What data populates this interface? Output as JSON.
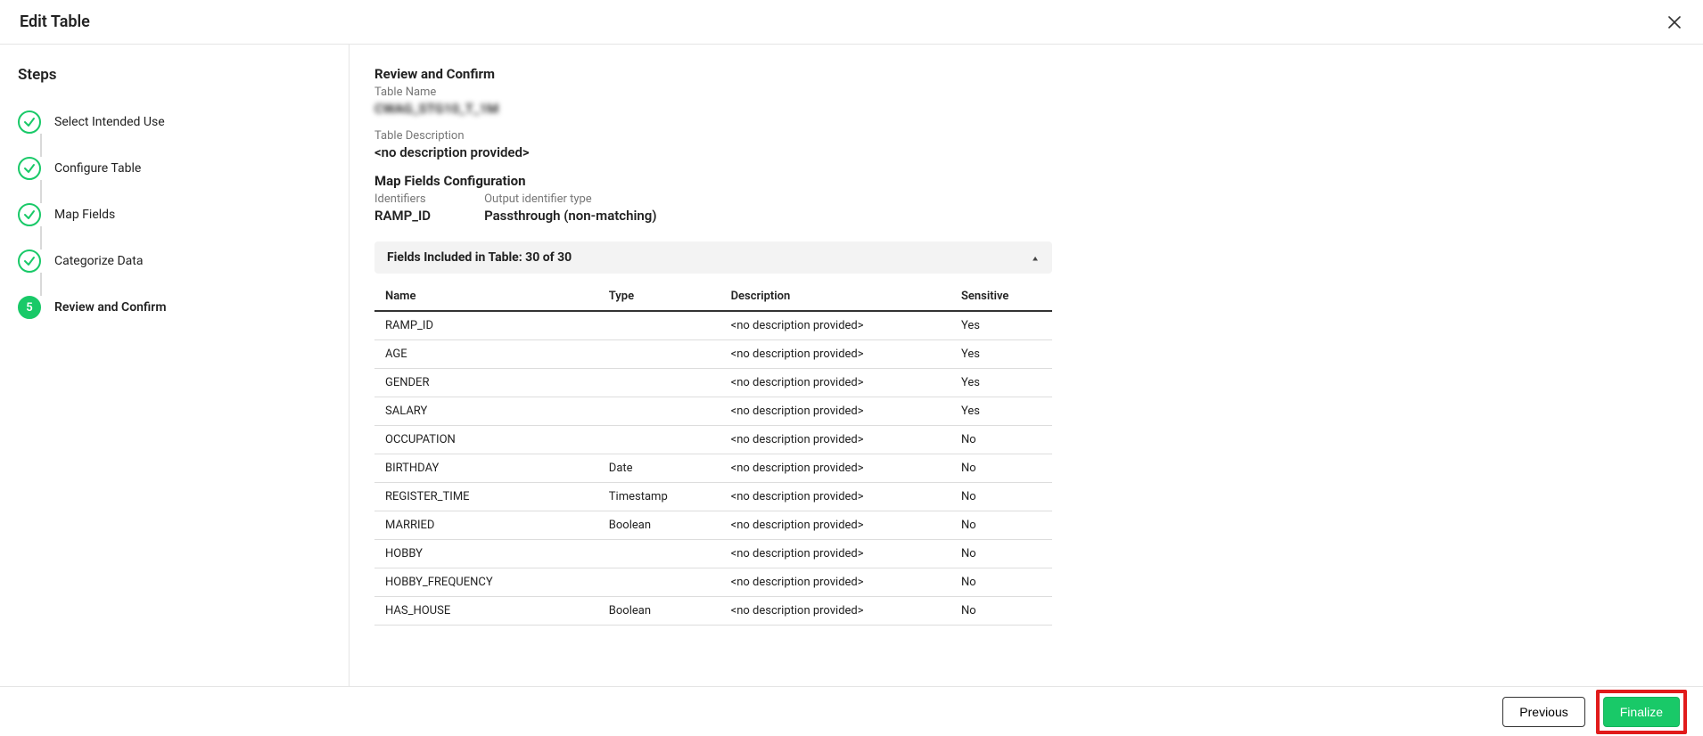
{
  "header": {
    "title": "Edit Table"
  },
  "sidebar": {
    "title": "Steps",
    "steps": [
      {
        "label": "Select Intended Use",
        "state": "completed"
      },
      {
        "label": "Configure Table",
        "state": "completed"
      },
      {
        "label": "Map Fields",
        "state": "completed"
      },
      {
        "label": "Categorize Data",
        "state": "completed"
      },
      {
        "label": "Review and Confirm",
        "state": "current",
        "number": "5"
      }
    ]
  },
  "review": {
    "heading": "Review and Confirm",
    "table_name_label": "Table Name",
    "table_name_value": "CWAG_STG10_T_1M",
    "table_desc_label": "Table Description",
    "table_desc_value": "<no description provided>",
    "map_heading": "Map Fields Configuration",
    "identifiers_label": "Identifiers",
    "identifiers_value": "RAMP_ID",
    "output_type_label": "Output identifier type",
    "output_type_value": "Passthrough (non-matching)",
    "fields_included_label": "Fields Included in Table: 30 of 30",
    "columns": {
      "name": "Name",
      "type": "Type",
      "description": "Description",
      "sensitive": "Sensitive"
    },
    "rows": [
      {
        "name": "RAMP_ID",
        "type": "",
        "description": "<no description provided>",
        "sensitive": "Yes"
      },
      {
        "name": "AGE",
        "type": "",
        "description": "<no description provided>",
        "sensitive": "Yes"
      },
      {
        "name": "GENDER",
        "type": "",
        "description": "<no description provided>",
        "sensitive": "Yes"
      },
      {
        "name": "SALARY",
        "type": "",
        "description": "<no description provided>",
        "sensitive": "Yes"
      },
      {
        "name": "OCCUPATION",
        "type": "",
        "description": "<no description provided>",
        "sensitive": "No"
      },
      {
        "name": "BIRTHDAY",
        "type": "Date",
        "description": "<no description provided>",
        "sensitive": "No"
      },
      {
        "name": "REGISTER_TIME",
        "type": "Timestamp",
        "description": "<no description provided>",
        "sensitive": "No"
      },
      {
        "name": "MARRIED",
        "type": "Boolean",
        "description": "<no description provided>",
        "sensitive": "No"
      },
      {
        "name": "HOBBY",
        "type": "",
        "description": "<no description provided>",
        "sensitive": "No"
      },
      {
        "name": "HOBBY_FREQUENCY",
        "type": "",
        "description": "<no description provided>",
        "sensitive": "No"
      },
      {
        "name": "HAS_HOUSE",
        "type": "Boolean",
        "description": "<no description provided>",
        "sensitive": "No"
      }
    ]
  },
  "footer": {
    "previous": "Previous",
    "finalize": "Finalize"
  }
}
